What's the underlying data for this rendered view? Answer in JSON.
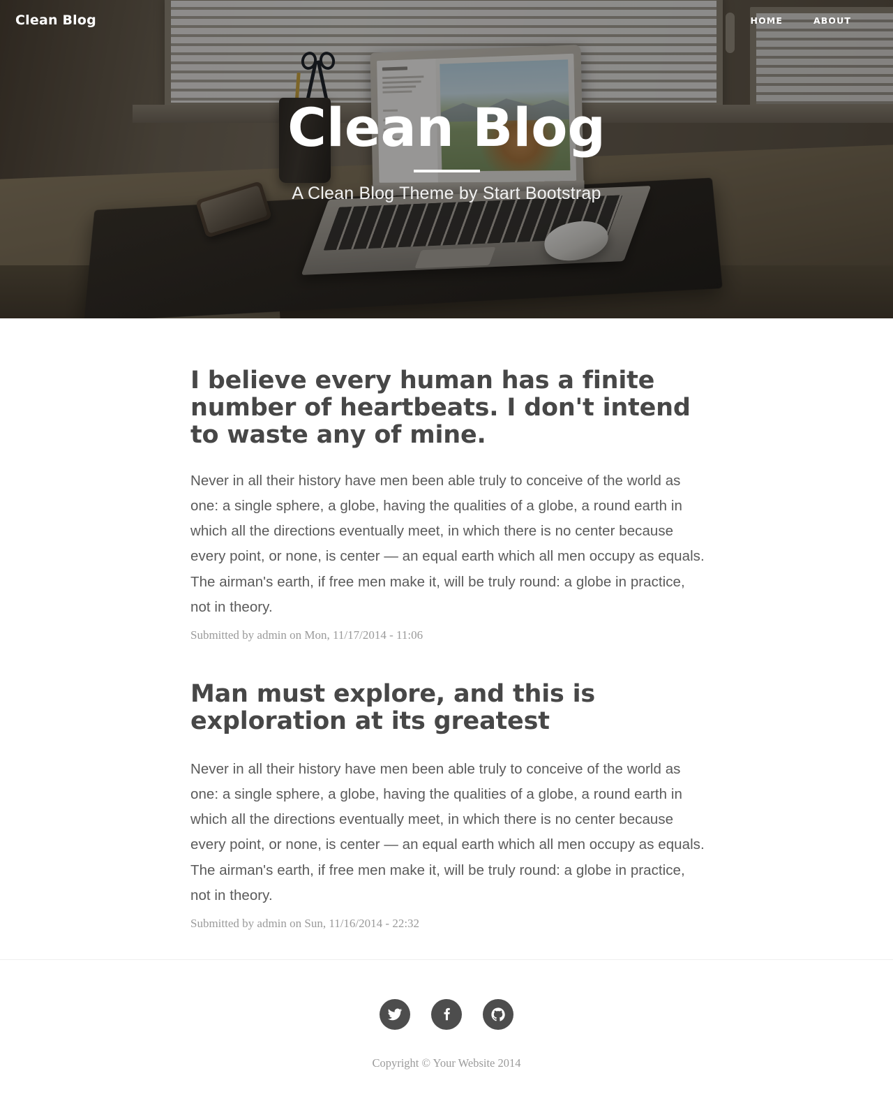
{
  "nav": {
    "brand": "Clean Blog",
    "links": [
      {
        "label": "Home",
        "name": "home"
      },
      {
        "label": "About",
        "name": "about"
      }
    ]
  },
  "hero": {
    "title": "Clean Blog",
    "subheading": "A Clean Blog Theme by Start Bootstrap",
    "overlay_color": "#000000"
  },
  "posts": [
    {
      "title": "I believe every human has a finite number of heartbeats. I don't intend to waste any of mine.",
      "body": "Never in all their history have men been able truly to conceive of the world as one: a single sphere, a globe, having the qualities of a globe, a round earth in which all the directions eventually meet, in which there is no center because every point, or none, is center — an equal earth which all men occupy as equals. The airman's earth, if free men make it, will be truly round: a globe in practice, not in theory.",
      "meta": "Submitted by admin on Mon, 11/17/2014 - 11:06"
    },
    {
      "title": "Man must explore, and this is exploration at its greatest",
      "body": "Never in all their history have men been able truly to conceive of the world as one: a single sphere, a globe, having the qualities of a globe, a round earth in which all the directions eventually meet, in which there is no center because every point, or none, is center — an equal earth which all men occupy as equals. The airman's earth, if free men make it, will be truly round: a globe in practice, not in theory.",
      "meta": "Submitted by admin on Sun, 11/16/2014 - 22:32"
    }
  ],
  "footer": {
    "social": [
      {
        "name": "twitter",
        "label": "Twitter"
      },
      {
        "name": "facebook",
        "label": "Facebook"
      },
      {
        "name": "github",
        "label": "GitHub"
      }
    ],
    "copyright": "Copyright © Your Website 2014",
    "icon_bg": "#4d4d4d"
  }
}
